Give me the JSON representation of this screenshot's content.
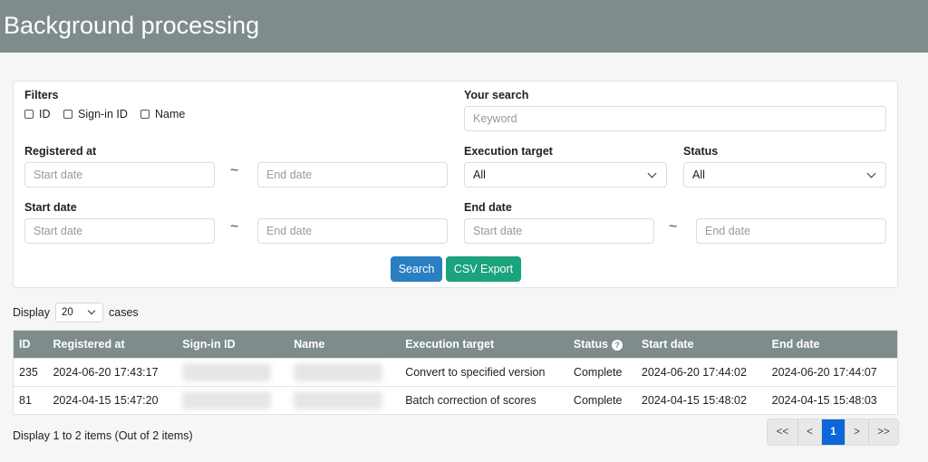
{
  "header": {
    "title": "Background processing"
  },
  "filters": {
    "label": "Filters",
    "checkboxes": [
      "ID",
      "Sign-in ID",
      "Name"
    ]
  },
  "your_search": {
    "label": "Your search",
    "placeholder": "Keyword"
  },
  "registered_at": {
    "label": "Registered at",
    "start_placeholder": "Start date",
    "end_placeholder": "End date"
  },
  "execution_target": {
    "label": "Execution target",
    "value": "All"
  },
  "status_filter": {
    "label": "Status",
    "value": "All"
  },
  "start_date": {
    "label": "Start date",
    "start_placeholder": "Start date",
    "end_placeholder": "End date"
  },
  "end_date": {
    "label": "End date",
    "start_placeholder": "Start date",
    "end_placeholder": "End date"
  },
  "range_separator": "~",
  "buttons": {
    "search": "Search",
    "csv_export": "CSV Export"
  },
  "display": {
    "prefix": "Display",
    "count": "20",
    "suffix": "cases"
  },
  "table": {
    "columns": [
      "ID",
      "Registered at",
      "Sign-in ID",
      "Name",
      "Execution target",
      "Status",
      "Start date",
      "End date"
    ],
    "rows": [
      {
        "id": "235",
        "registered": "2024-06-20 17:43:17",
        "target": "Convert to specified version",
        "status": "Complete",
        "start": "2024-06-20 17:44:02",
        "end": "2024-06-20 17:44:07"
      },
      {
        "id": "81",
        "registered": "2024-04-15 15:47:20",
        "target": "Batch correction of scores",
        "status": "Complete",
        "start": "2024-04-15 15:48:02",
        "end": "2024-04-15 15:48:03"
      }
    ]
  },
  "summary": "Display 1 to 2 items (Out of 2 items)",
  "pagination": {
    "first": "<<",
    "prev": "<",
    "current": "1",
    "next": ">",
    "last": ">>"
  },
  "icons": {
    "help": "question-circle-icon",
    "dropdown": "chevron-down-icon"
  }
}
